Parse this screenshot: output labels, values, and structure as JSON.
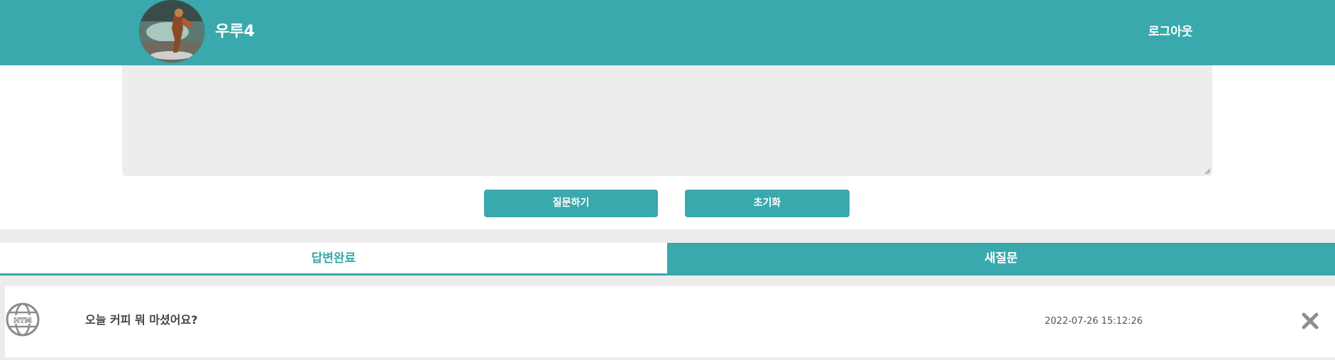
{
  "header": {
    "username": "우루4",
    "logout_label": "로그아웃",
    "accent_color": "#39a9ad"
  },
  "question_form": {
    "textarea_value": "",
    "submit_label": "질문하기",
    "reset_label": "초기화"
  },
  "tabs": [
    {
      "label": "답변완료",
      "active": false
    },
    {
      "label": "새질문",
      "active": true
    }
  ],
  "questions": [
    {
      "text": "오늘 커피 뭐 마셨어요?",
      "timestamp": "2022-07-26 15:12:26",
      "icon": "globe-icon"
    }
  ]
}
